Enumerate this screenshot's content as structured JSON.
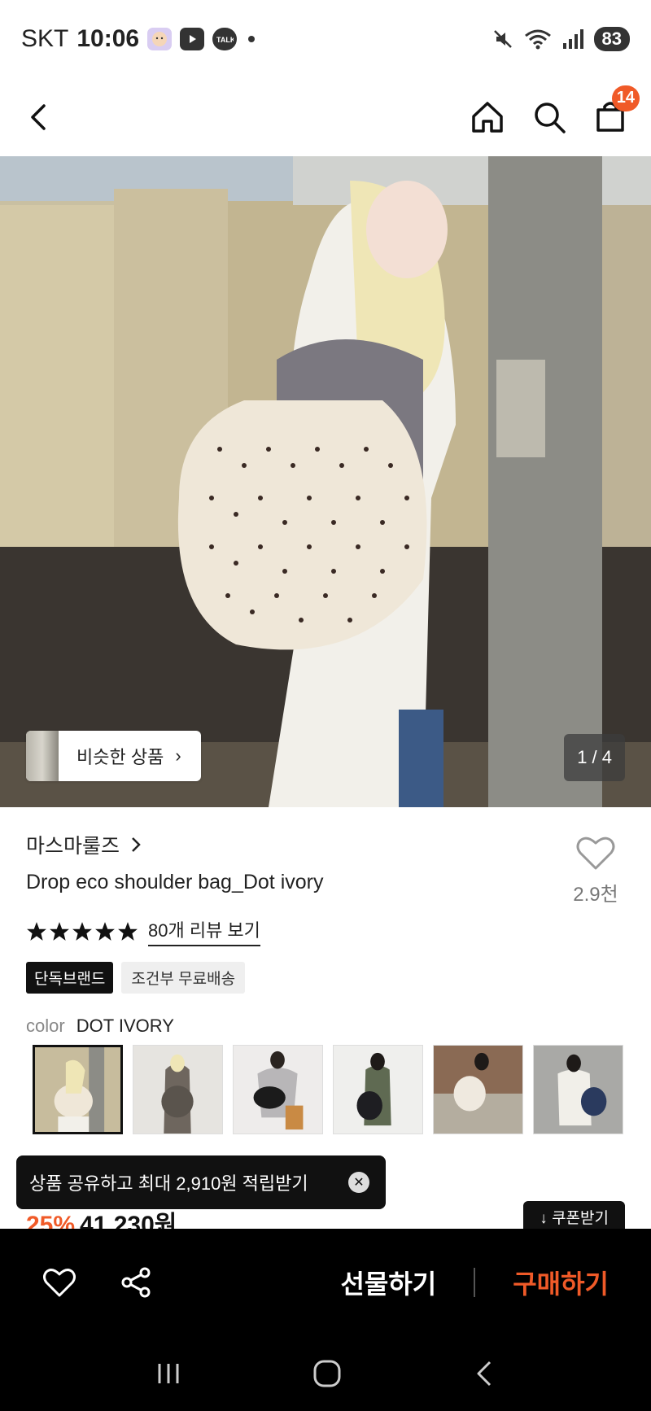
{
  "status_bar": {
    "carrier": "SKT",
    "time": "10:06",
    "battery": "83",
    "icons": [
      "avatar-app-icon",
      "youtube-icon",
      "kakaotalk-icon",
      "dot-icon",
      "mute-icon",
      "wifi-icon",
      "signal-icon"
    ]
  },
  "nav": {
    "cart_count": "14",
    "icons": [
      "back-icon",
      "home-icon",
      "search-icon",
      "cart-icon"
    ]
  },
  "hero": {
    "similar_label": "비슷한 상품",
    "page_counter": "1 / 4"
  },
  "product": {
    "brand": "마스마룰즈",
    "title": "Drop eco shoulder bag_Dot ivory",
    "like_count": "2.9천",
    "rating_stars": 5,
    "review_link": "80개 리뷰 보기",
    "badges": [
      "단독브랜드",
      "조건부 무료배송"
    ],
    "color_label": "color",
    "color_value": "DOT IVORY",
    "price_discount": "25%",
    "price": "41,230원",
    "coupon_label": "↓ 쿠폰받기"
  },
  "toast": {
    "message": "상품 공유하고 최대 2,910원 적립받기"
  },
  "bottom_bar": {
    "gift_label": "선물하기",
    "buy_label": "구매하기"
  },
  "colors": {
    "accent": "#f05a28",
    "dark": "#111111"
  }
}
